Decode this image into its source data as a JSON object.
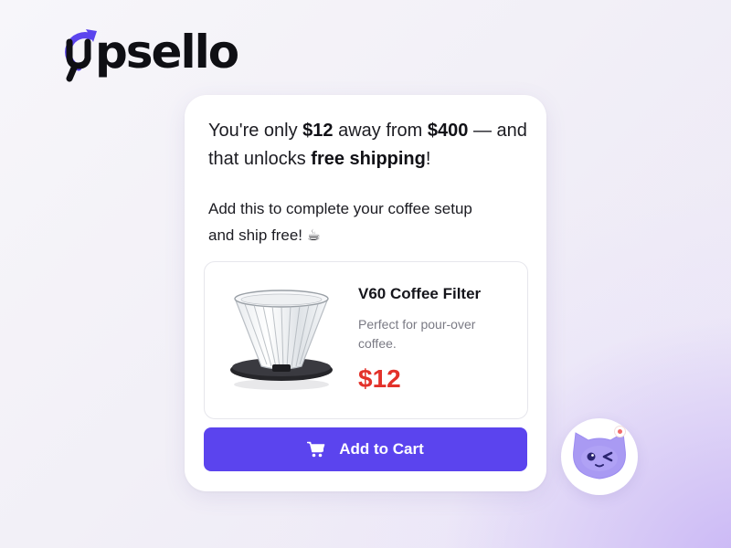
{
  "brand": {
    "name": "upsello",
    "text_after_mark": "psello",
    "accent_color": "#5b44ee",
    "logo_icon": "circular-arrow-u-icon"
  },
  "upsell_card": {
    "headline": {
      "prefix": "You're only ",
      "amount_away": "$12",
      "middle": " away from ",
      "threshold": "$400",
      "dash": " — and that unlocks ",
      "reward": "free shipping",
      "suffix": "!"
    },
    "subtext": "Add this to complete your coffee setup and ship free! ☕",
    "product": {
      "name": "V60 Coffee Filter",
      "description": "Perfect for pour-over coffee.",
      "price": "$12",
      "price_color": "#e3312a",
      "image_icon": "pour-over-dripper-icon"
    },
    "add_to_cart": {
      "label": "Add to Cart",
      "icon": "cart-icon",
      "color": "#5b44ee"
    }
  },
  "chat_widget": {
    "icon": "winking-cat-mascot-icon",
    "notification": "red-dot-icon"
  }
}
